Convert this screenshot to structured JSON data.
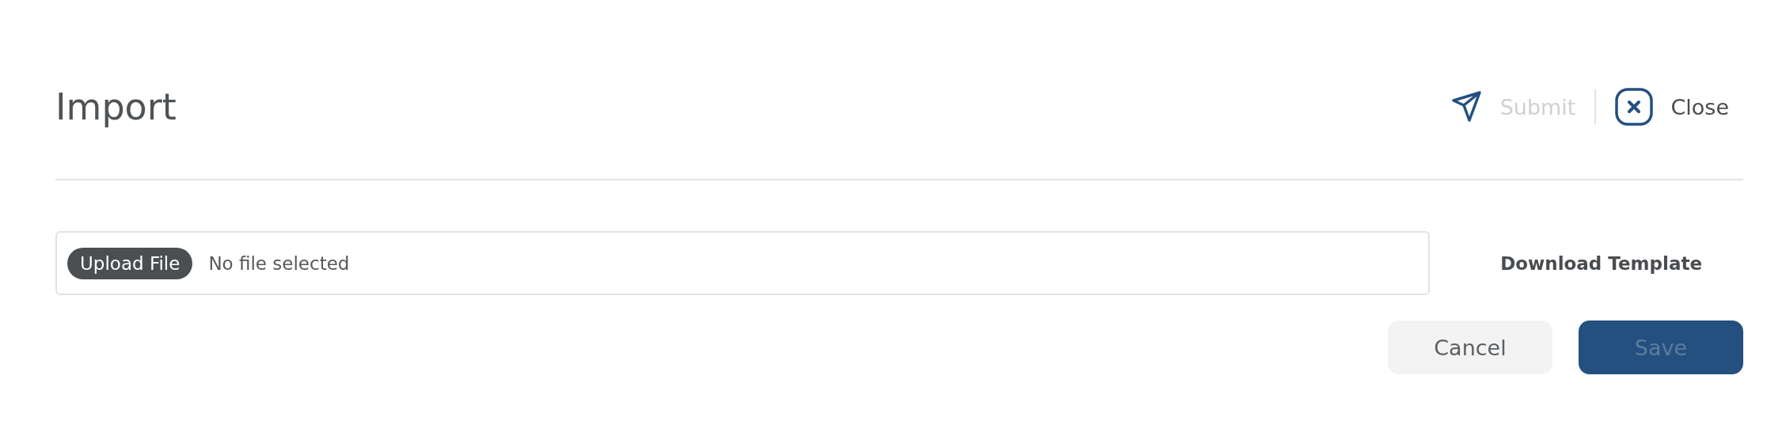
{
  "title": "Import",
  "header_actions": [
    {
      "kind": "submit",
      "label": "Submit",
      "disabled": true
    },
    {
      "kind": "close",
      "label": "Close",
      "disabled": false
    }
  ],
  "file_field": {
    "button": "Upload File",
    "value": "No file selected"
  },
  "download_link": "Download Template",
  "buttons": [
    {
      "kind": "secondary",
      "label": "Cancel",
      "disabled": false
    },
    {
      "kind": "primary",
      "label": "Save",
      "disabled": true
    }
  ]
}
